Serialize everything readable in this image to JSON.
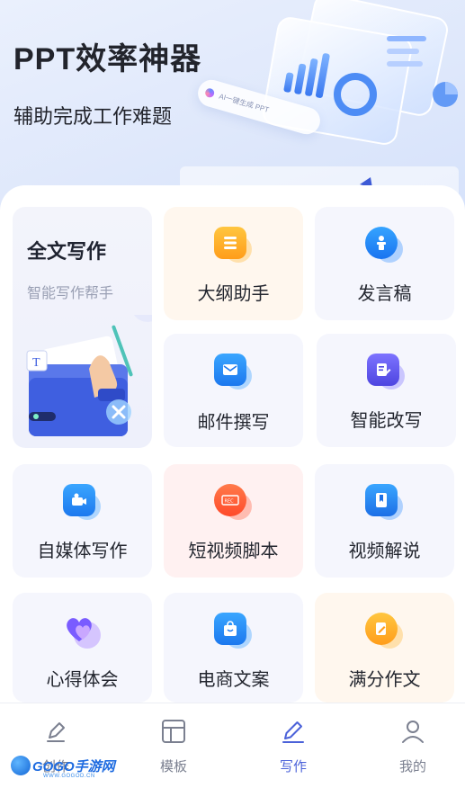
{
  "hero": {
    "title": "PPT效率神器",
    "subtitle": "辅助完成工作难题",
    "pill_text": "AI一键生成 PPT"
  },
  "featured": {
    "title": "全文写作",
    "subtitle": "智能写作帮手",
    "illustration_text": "T"
  },
  "tools": [
    {
      "label": "大纲助手",
      "icon": "outline-icon"
    },
    {
      "label": "发言稿",
      "icon": "speech-icon"
    },
    {
      "label": "邮件撰写",
      "icon": "mail-icon"
    },
    {
      "label": "智能改写",
      "icon": "rewrite-icon"
    },
    {
      "label": "自媒体写作",
      "icon": "media-writing-icon"
    },
    {
      "label": "短视频脚本",
      "icon": "short-video-icon"
    },
    {
      "label": "视频解说",
      "icon": "video-commentary-icon"
    },
    {
      "label": "心得体会",
      "icon": "heart-icon"
    },
    {
      "label": "电商文案",
      "icon": "shopping-bag-icon"
    },
    {
      "label": "满分作文",
      "icon": "essay-icon"
    }
  ],
  "tabbar": {
    "items": [
      {
        "label": "创作",
        "icon": "pen-create-icon"
      },
      {
        "label": "模板",
        "icon": "template-icon"
      },
      {
        "label": "写作",
        "icon": "pencil-icon"
      },
      {
        "label": "我的",
        "icon": "profile-icon"
      }
    ],
    "active": "写作"
  },
  "watermark": {
    "text": "GOGO手游网",
    "url": "WWW.GOGOD.CN"
  },
  "colors": {
    "accent": "#4b62d9",
    "card_bg": "#f5f6fd",
    "warm_card_bg": "#fff7ee",
    "pink_card_bg": "#fff1f1"
  }
}
